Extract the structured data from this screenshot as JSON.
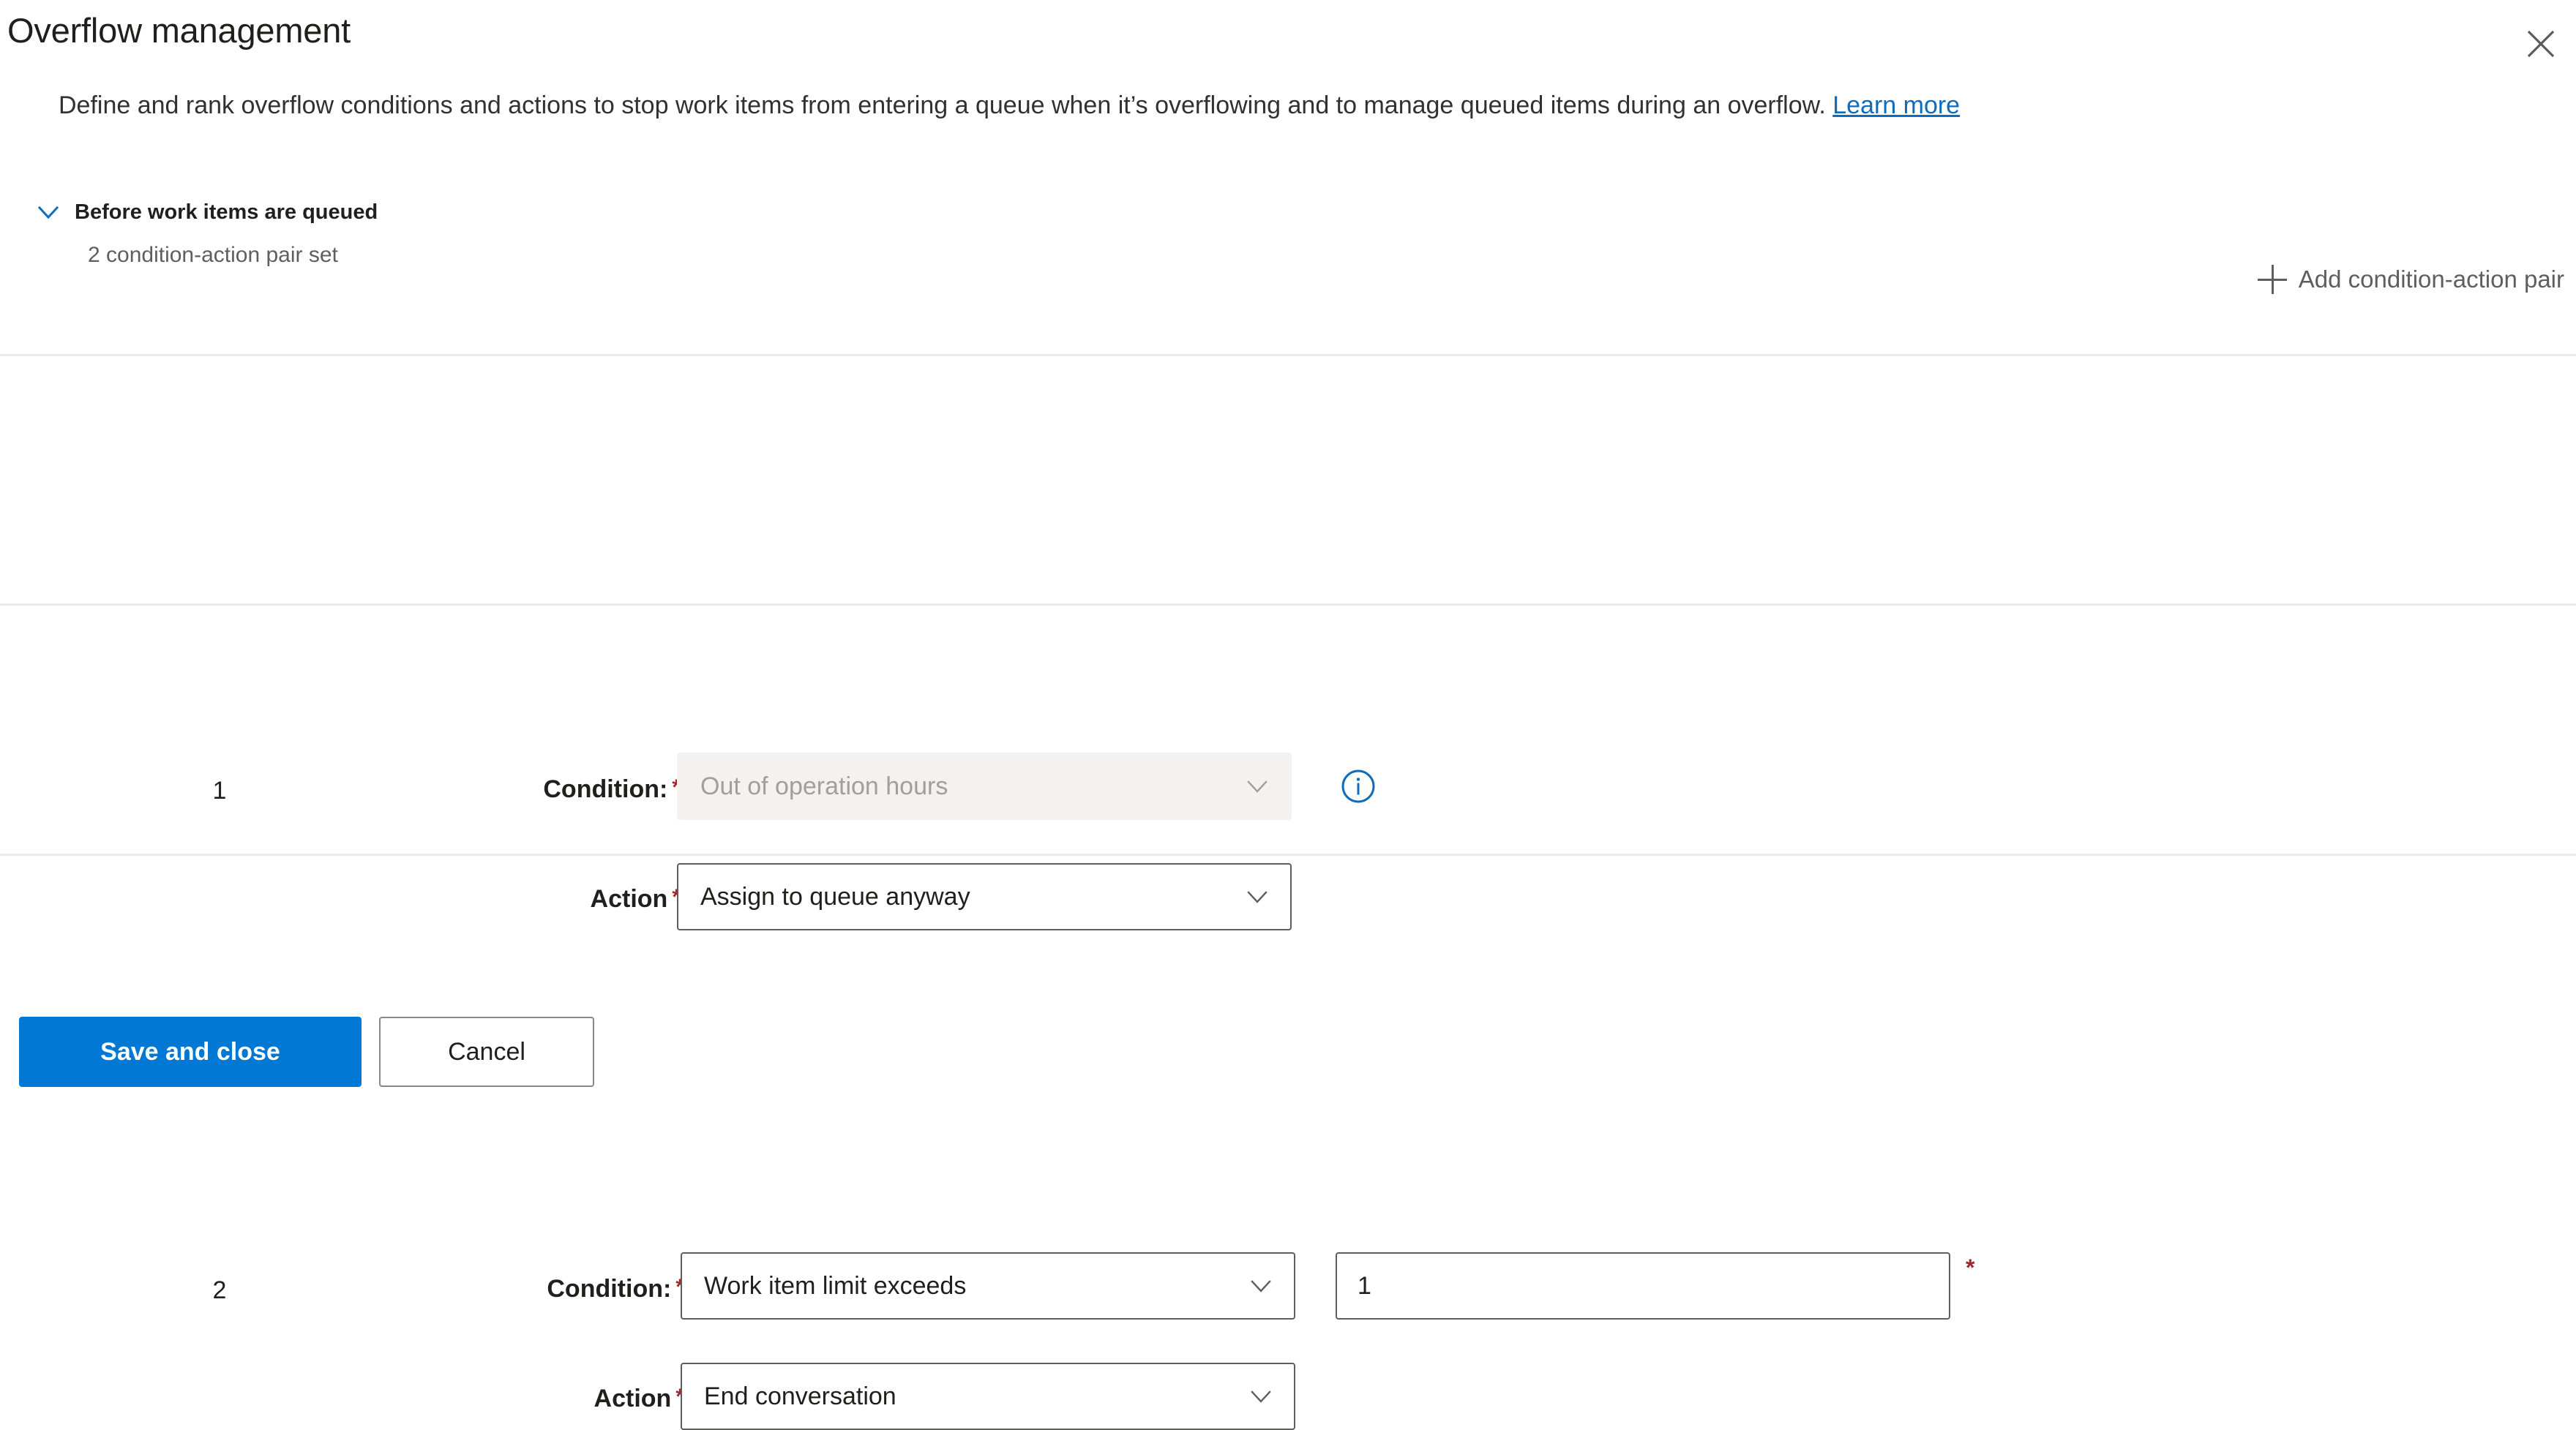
{
  "header": {
    "title": "Overflow management",
    "close_icon": "close-icon",
    "description_prefix": "Define and rank overflow conditions and actions to stop work items from entering a queue when it’s overflowing and to manage queued items during an overflow. ",
    "learn_more_label": "Learn more"
  },
  "section": {
    "chevron_icon": "chevron-down-icon",
    "title": "Before work items are queued",
    "subtitle": "2 condition-action pair set",
    "add_pair": {
      "icon": "plus-icon",
      "label": "Add condition-action pair"
    }
  },
  "labels": {
    "condition": "Condition:",
    "action": "Action",
    "required_marker": "*"
  },
  "rows": [
    {
      "rank": "1",
      "condition": {
        "value": "Out of operation hours",
        "disabled": true,
        "chevron_icon": "chevron-down-icon"
      },
      "info_icon": "info-icon",
      "action": {
        "value": "Assign to queue anyway",
        "disabled": false,
        "chevron_icon": "chevron-down-icon"
      }
    },
    {
      "rank": "2",
      "condition": {
        "value": "Work item limit exceeds",
        "disabled": false,
        "chevron_icon": "chevron-down-icon"
      },
      "limit_value": "1",
      "limit_required_marker": "*",
      "action": {
        "value": "End conversation",
        "disabled": false,
        "chevron_icon": "chevron-down-icon"
      }
    }
  ],
  "footer": {
    "save_label": "Save and close",
    "cancel_label": "Cancel"
  },
  "colors": {
    "primary": "#0078d4",
    "link": "#0f6cbd",
    "required": "#a4262c",
    "accent_icon": "#0f6cbd",
    "divider": "#ebebeb",
    "disabled_bg": "#f3f2f1",
    "disabled_text": "#a19f9d"
  }
}
